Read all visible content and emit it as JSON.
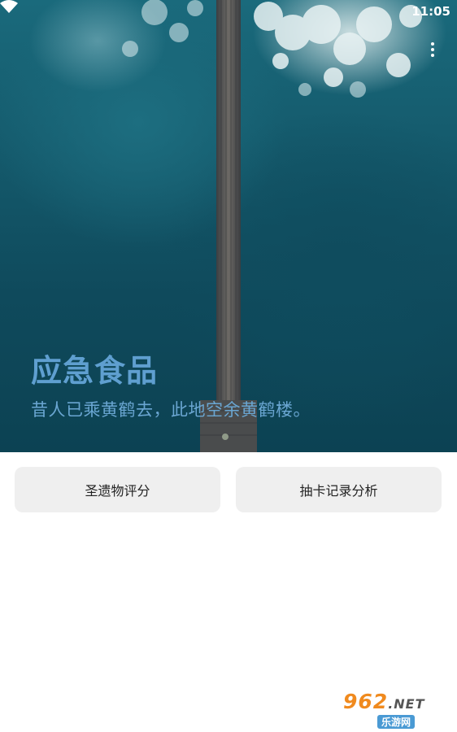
{
  "status_bar": {
    "time": "11:05",
    "wifi_icon": "wifi-icon"
  },
  "hero": {
    "title": "应急食品",
    "subtitle": "昔人已乘黄鹤去，此地空余黄鹤楼。",
    "menu_icon": "more-vert-icon",
    "title_color": "#5f9fd0"
  },
  "buttons": {
    "relic_score": "圣遗物评分",
    "gacha_analysis": "抽卡记录分析"
  },
  "watermark": {
    "logo": "962",
    "domain": ".NET",
    "name": "乐游网"
  }
}
